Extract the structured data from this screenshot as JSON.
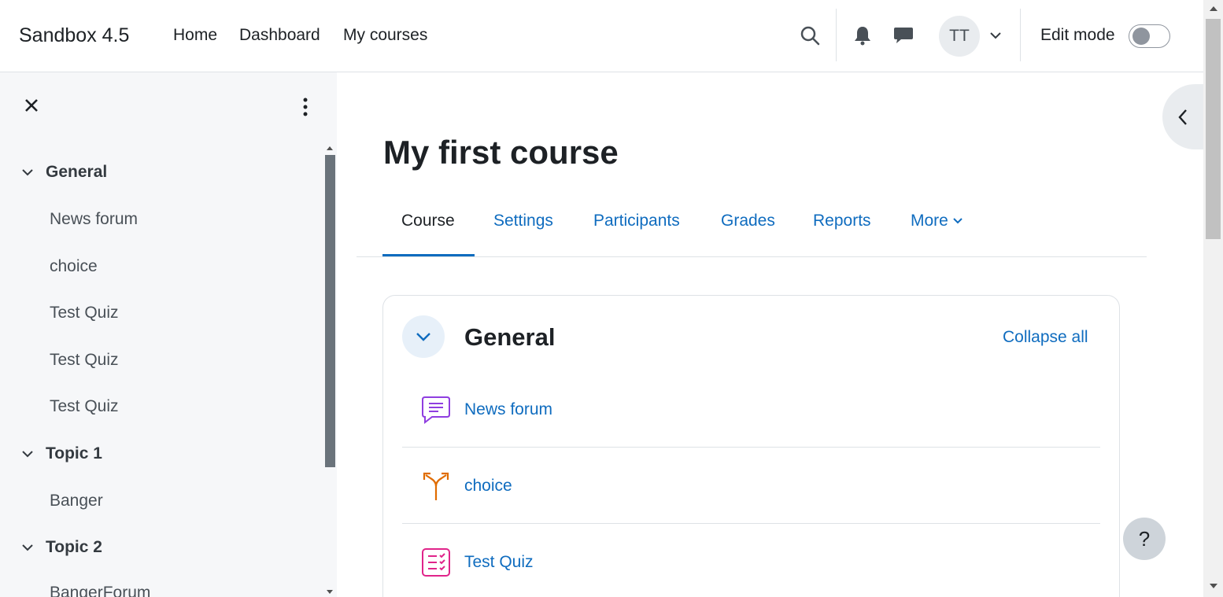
{
  "navbar": {
    "brand": "Sandbox 4.5",
    "links": [
      "Home",
      "Dashboard",
      "My courses"
    ],
    "icons": [
      "search-icon",
      "bell-icon",
      "message-icon",
      "chevron-down-icon"
    ],
    "user_initials": "TT",
    "edit_mode_label": "Edit mode",
    "edit_mode_on": false
  },
  "drawer": {
    "icons": [
      "close-icon",
      "kebab-menu-icon"
    ],
    "sections": [
      {
        "title": "General",
        "items": [
          "News forum",
          "choice",
          "Test Quiz",
          "Test Quiz",
          "Test Quiz"
        ]
      },
      {
        "title": "Topic 1",
        "items": [
          "Banger"
        ]
      },
      {
        "title": "Topic 2",
        "items": [
          "BangerForum"
        ]
      }
    ]
  },
  "main": {
    "title": "My first course",
    "tabs": [
      "Course",
      "Settings",
      "Participants",
      "Grades",
      "Reports",
      "More"
    ],
    "active_tab": "Course",
    "section": {
      "title": "General",
      "collapse_all": "Collapse all",
      "activities": [
        {
          "name": "News forum",
          "icon": "forum-icon",
          "color": "#8f3ee0"
        },
        {
          "name": "choice",
          "icon": "choice-icon",
          "color": "#e06c00"
        },
        {
          "name": "Test Quiz",
          "icon": "quiz-icon",
          "color": "#e0248a"
        }
      ]
    }
  },
  "help": {
    "label": "?"
  },
  "colors": {
    "link": "#0f6cbf",
    "drawer_bg": "#f6f7f9",
    "text": "#1d2125"
  }
}
